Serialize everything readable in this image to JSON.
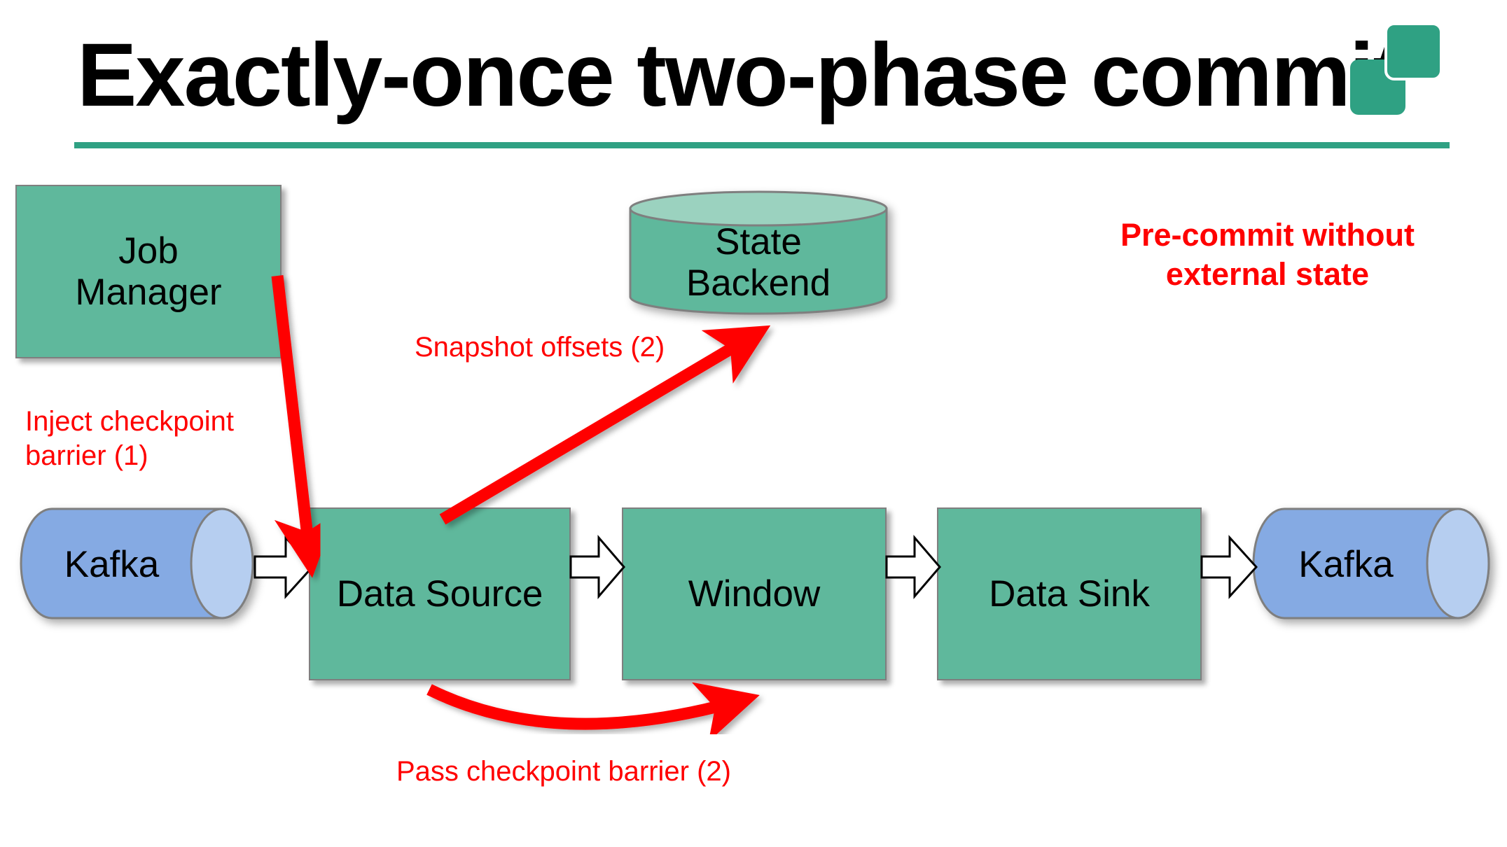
{
  "slide": {
    "title": "Exactly-once two-phase commit",
    "background": "#ffffff",
    "accent_color": "#2FA183",
    "box_color": "#5FB89C",
    "kafka_color": "#85AAE3",
    "annotation_color": "#FF0000"
  },
  "logo": {
    "name": "data-artisans-logo",
    "color": "#2FA183"
  },
  "nodes": {
    "job_manager": "Job\nManager",
    "state_backend": "State\nBackend",
    "kafka_source": "Kafka",
    "data_source": "Data Source",
    "window": "Window",
    "data_sink": "Data Sink",
    "kafka_sink": "Kafka"
  },
  "annotations": {
    "inject_barrier": "Inject checkpoint\nbarrier (1)",
    "snapshot_offsets": "Snapshot offsets (2)",
    "pass_barrier": "Pass checkpoint barrier (2)",
    "pre_commit": "Pre-commit without\nexternal state"
  }
}
